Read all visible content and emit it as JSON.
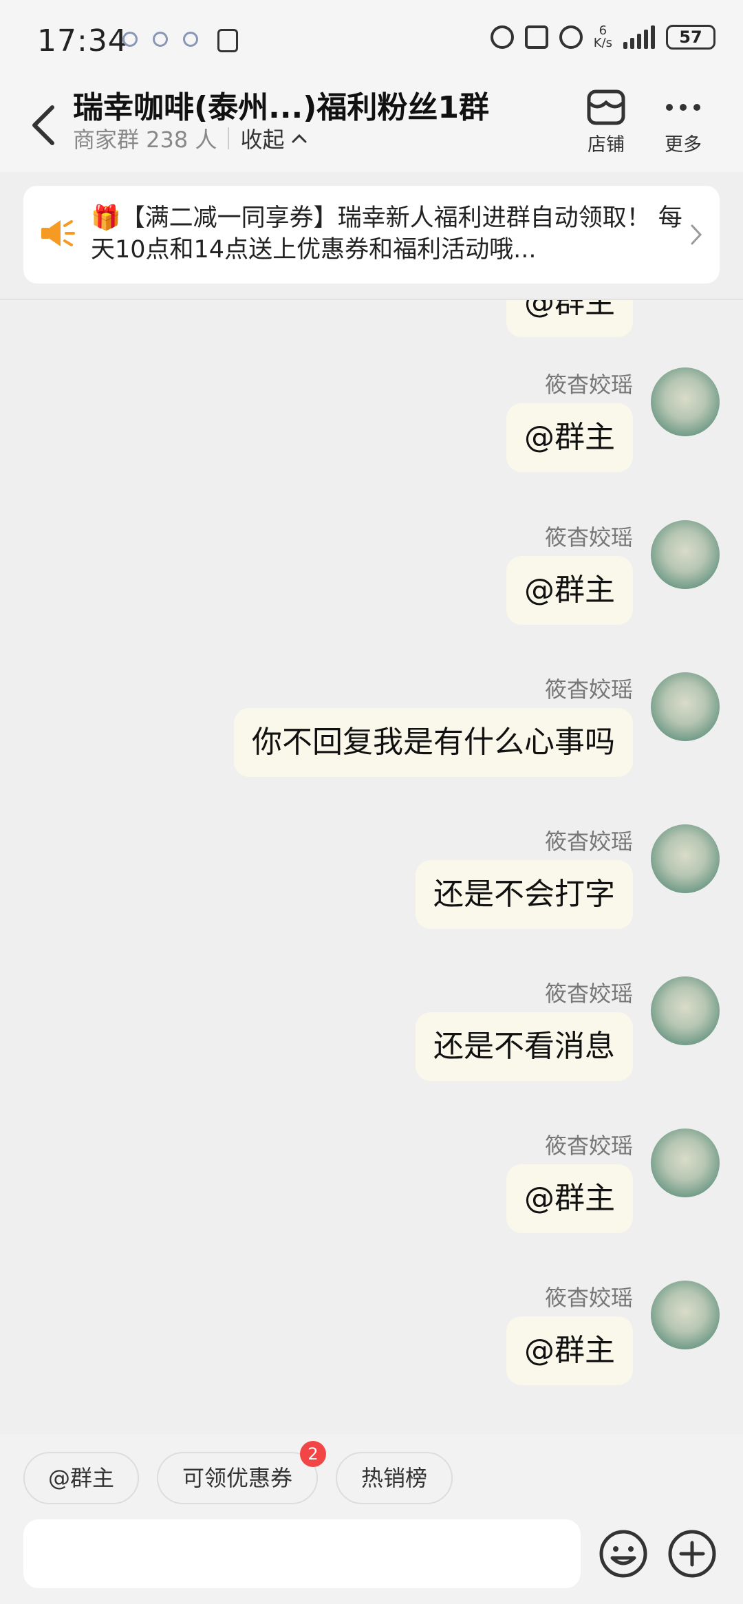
{
  "status_bar": {
    "time": "17:34",
    "speed_value": "6",
    "speed_unit": "K/s",
    "battery": "57"
  },
  "header": {
    "title": "瑞幸咖啡(泰州...)福利粉丝1群",
    "subtitle": "商家群 238 人",
    "collapse_label": "收起",
    "store_label": "店铺",
    "more_label": "更多"
  },
  "notice": {
    "icon": "megaphone-icon",
    "text": "🎁【满二减一同享券】瑞幸新人福利进群自动领取！ 每天10点和14点送上优惠券和福利活动哦..."
  },
  "messages": [
    {
      "sender": "筱杳姣瑶",
      "text": "@群主"
    },
    {
      "sender": "筱杳姣瑶",
      "text": "@群主"
    },
    {
      "sender": "筱杳姣瑶",
      "text": "你不回复我是有什么心事吗"
    },
    {
      "sender": "筱杳姣瑶",
      "text": "还是不会打字"
    },
    {
      "sender": "筱杳姣瑶",
      "text": "还是不看消息"
    },
    {
      "sender": "筱杳姣瑶",
      "text": "@群主"
    },
    {
      "sender": "筱杳姣瑶",
      "text": "@群主"
    }
  ],
  "partial_top_message": {
    "text": "@群主"
  },
  "quick_actions": [
    {
      "label": "@群主"
    },
    {
      "label": "可领优惠券",
      "badge": "2"
    },
    {
      "label": "热销榜"
    }
  ],
  "input": {
    "placeholder": ""
  },
  "colors": {
    "bubble": "#faf8ea",
    "badge": "#f24545",
    "megaphone": "#f59a23"
  }
}
